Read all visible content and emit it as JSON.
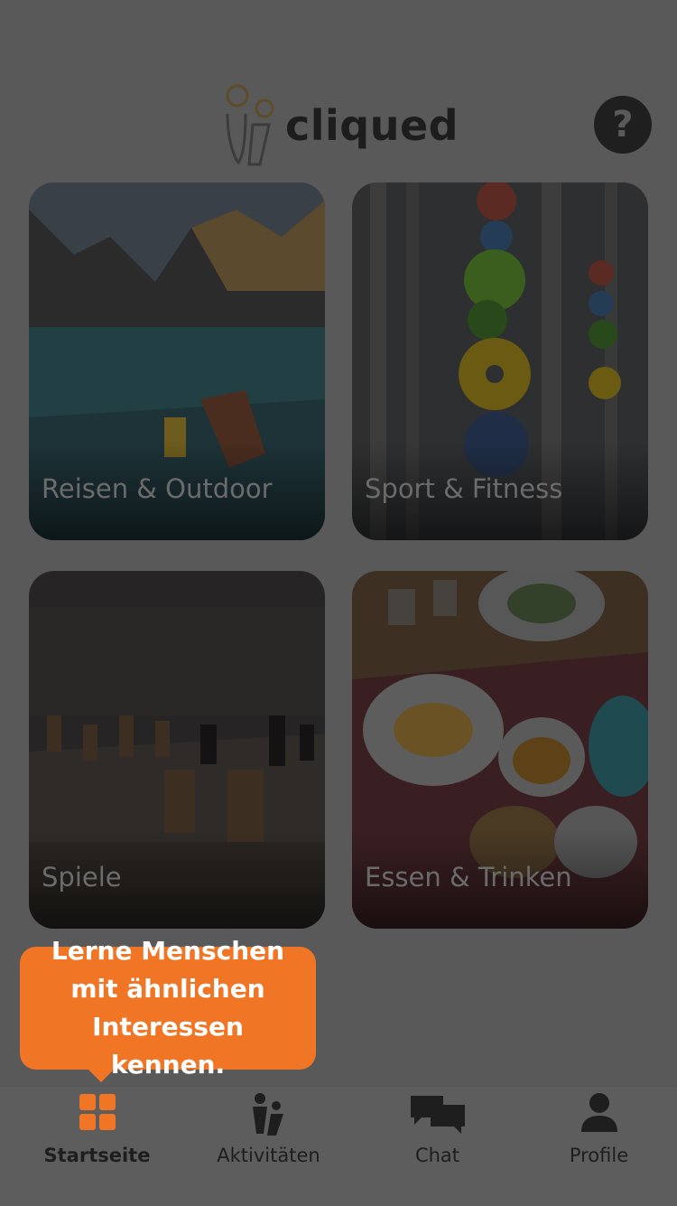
{
  "app": {
    "name": "cliqued"
  },
  "header": {
    "help_label": "?"
  },
  "categories": [
    {
      "label": "Reisen & Outdoor"
    },
    {
      "label": "Sport & Fitness"
    },
    {
      "label": "Spiele"
    },
    {
      "label": "Essen & Trinken"
    }
  ],
  "tooltip": {
    "text": "Lerne Menschen mit ähnlichen Interessen kennen."
  },
  "tabbar": {
    "tabs": [
      {
        "label": "Startseite",
        "icon": "grid-icon",
        "active": true
      },
      {
        "label": "Aktivitäten",
        "icon": "people-icon",
        "active": false
      },
      {
        "label": "Chat",
        "icon": "chat-bubbles-icon",
        "active": false
      },
      {
        "label": "Profile",
        "icon": "user-icon",
        "active": false
      }
    ]
  },
  "colors": {
    "accent": "#f07525",
    "overlay": "#595959"
  }
}
